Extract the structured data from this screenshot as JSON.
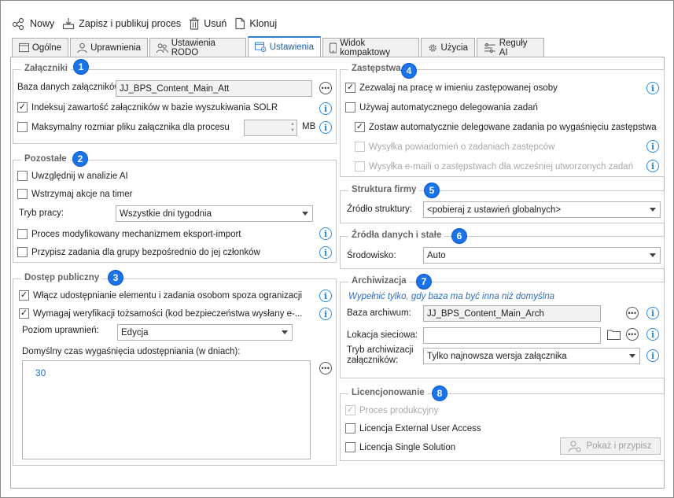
{
  "toolbar": {
    "new_label": "Nowy",
    "save_publish_label": "Zapisz i publikuj proces",
    "delete_label": "Usuń",
    "clone_label": "Klonuj"
  },
  "tabs": [
    {
      "label": "Ogólne",
      "icon": "window-icon"
    },
    {
      "label": "Uprawnienia",
      "icon": "user-icon"
    },
    {
      "label": "Ustawienia RODO",
      "icon": "users-icon"
    },
    {
      "label": "Ustawienia",
      "icon": "settings-window-icon",
      "active": true
    },
    {
      "label": "Widok kompaktowy",
      "icon": "phone-icon"
    },
    {
      "label": "Użycia",
      "icon": "gear-icon"
    },
    {
      "label": "Reguły AI",
      "icon": "rules-icon"
    }
  ],
  "attachments": {
    "title": "Załączniki",
    "badge": "1",
    "db_label": "Baza danych załączników:",
    "db_value": "JJ_BPS_Content_Main_Att",
    "index_label": "Indeksuj zawartość załączników w bazie wyszukiwania SOLR",
    "max_size_label": "Maksymalny rozmiar pliku załącznika dla procesu",
    "max_size_unit": "MB"
  },
  "other": {
    "title": "Pozostałe",
    "badge": "2",
    "ai_label": "Uwzględnij w analizie AI",
    "timer_label": "Wstrzymaj akcje na timer",
    "mode_label": "Tryb pracy:",
    "mode_value": "Wszystkie dni tygodnia",
    "modified_label": "Proces modyfikowany mechanizmem eksport-import",
    "assign_label": "Przypisz zadania dla grupy bezpośrednio do jej członków"
  },
  "public_access": {
    "title": "Dostęp publiczny",
    "badge": "3",
    "enable_label": "Włącz udostępnianie elementu i zadania osobom spoza ogranizacji",
    "verify_label": "Wymagaj weryfikacji tożsamości (kod bezpieczeństwa wysłany e-...",
    "level_label": "Poziom uprawnień:",
    "level_value": "Edycja",
    "expiry_label": "Domyślny czas wygaśnięcia udostępniania (w dniach):",
    "expiry_value": "30"
  },
  "substitutions": {
    "title": "Zastępstwa",
    "badge": "4",
    "allow_label": "Zezwalaj na pracę w imieniu zastępowanej osoby",
    "auto_delegate_label": "Używaj automatycznego delegowania zadań",
    "keep_delegated_label": "Zostaw automatycznie delegowane zadania po wygaśnięciu zastępstwa",
    "notify_label": "Wysyłka powiadomień o zadaniach zastępców",
    "email_label": "Wysyłka e-maili o zastępstwach dla wcześniej utworzonych zadań"
  },
  "structure": {
    "title": "Struktura firmy",
    "badge": "5",
    "source_label": "Źródło struktury:",
    "source_value": "<pobieraj z ustawień globalnych>"
  },
  "data_sources": {
    "title": "Źródła danych i stałe",
    "badge": "6",
    "env_label": "Środowisko:",
    "env_value": "Auto"
  },
  "archiving": {
    "title": "Archiwizacja",
    "badge": "7",
    "note": "Wypełnić tylko, gdy baza ma być inna niż domyślna",
    "db_label": "Baza archiwum:",
    "db_value": "JJ_BPS_Content_Main_Arch",
    "network_label": "Lokacja sieciowa:",
    "network_value": "",
    "mode_label_line1": "Tryb archiwizacji",
    "mode_label_line2": "załączników:",
    "mode_value": "Tylko najnowsza wersja załącznika"
  },
  "licensing": {
    "title": "Licencjonowanie",
    "badge": "8",
    "production_label": "Proces produkcyjny",
    "external_label": "Licencja External User Access",
    "single_label": "Licencja Single Solution",
    "show_assign_label": "Pokaż i przypisz"
  },
  "colors": {
    "accent": "#1a73e8",
    "info": "#2a8be0",
    "note": "#2a6fc4"
  }
}
